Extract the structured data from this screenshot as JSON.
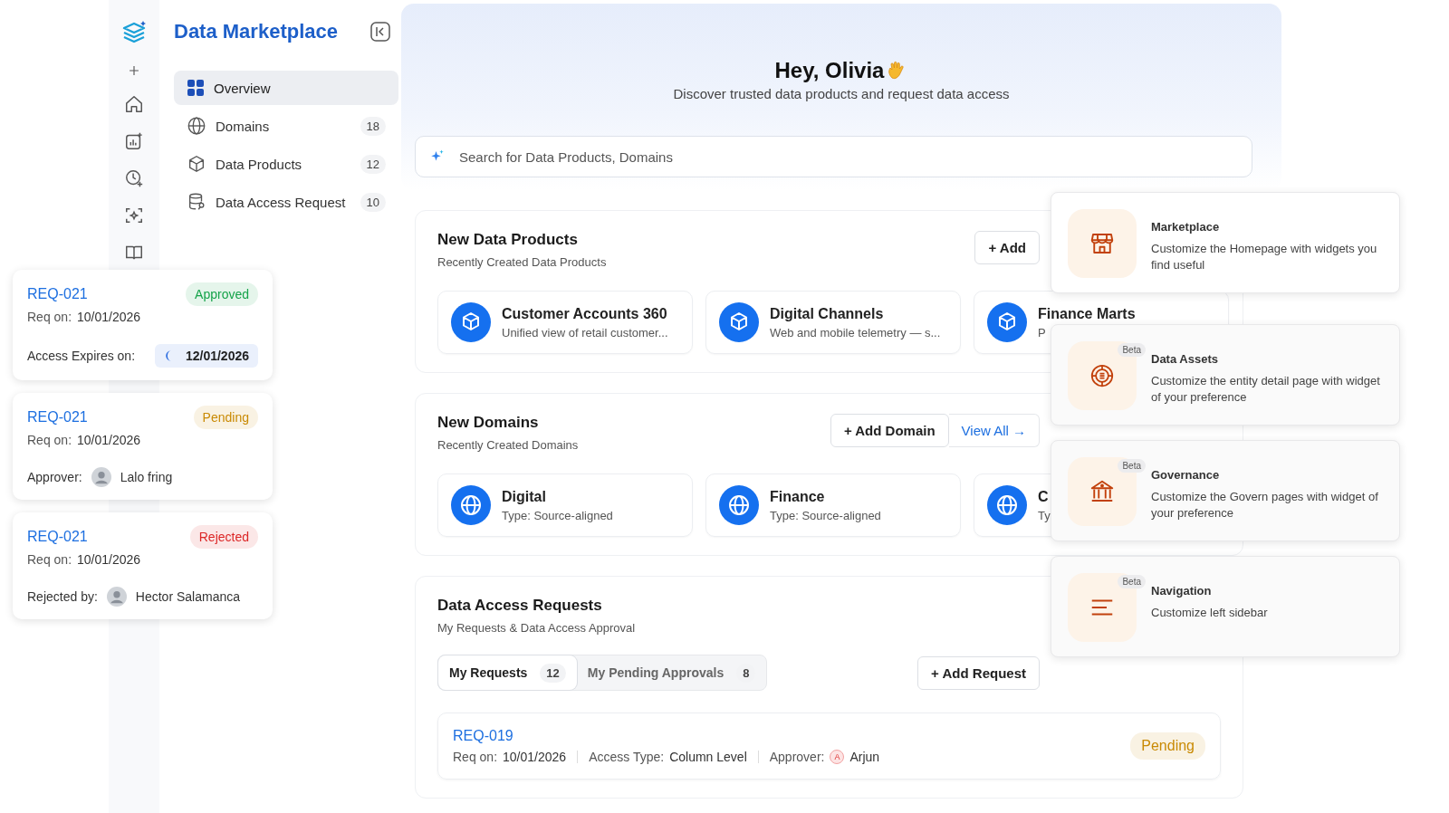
{
  "app": {
    "title": "Data Marketplace"
  },
  "nav": {
    "items": [
      {
        "label": "Overview",
        "kind": "grid",
        "selected": true
      },
      {
        "label": "Domains",
        "kind": "globe",
        "count": "18",
        "selected": false
      },
      {
        "label": "Data Products",
        "kind": "cube",
        "count": "12",
        "selected": false
      },
      {
        "label": "Data Access Request",
        "kind": "database",
        "count": "10",
        "selected": false
      }
    ]
  },
  "hero": {
    "greeting": "Hey, Olivia",
    "subtitle": "Discover trusted data products and request data access"
  },
  "search": {
    "placeholder": "Search for Data Products, Domains"
  },
  "data_products": {
    "title": "New Data Products",
    "subtitle": "Recently Created Data Products",
    "actions": [
      {
        "label": "+ Add",
        "kind": "button"
      }
    ],
    "items": [
      {
        "name": "Customer Accounts 360",
        "description": "Unified view of retail customer..."
      },
      {
        "name": "Digital Channels",
        "description": "Web and mobile telemetry — s..."
      },
      {
        "name": "Finance Marts",
        "description": "P"
      }
    ]
  },
  "domains": {
    "title": "New Domains",
    "subtitle": "Recently Created Domains",
    "actions": [
      {
        "label": "+ Add Domain",
        "kind": "button"
      },
      {
        "label": "View All →",
        "kind": "link"
      }
    ],
    "items": [
      {
        "name": "Digital",
        "description": "Type: Source-aligned"
      },
      {
        "name": "Finance",
        "description": "Type: Source-aligned"
      },
      {
        "name": "C",
        "description": "Ty"
      }
    ]
  },
  "access_requests": {
    "title": "Data Access Requests",
    "subtitle": "My Requests & Data Access Approval",
    "tabs": [
      {
        "label": "My Requests",
        "count": "12",
        "selected": true
      },
      {
        "label": "My Pending Approvals",
        "count": "8",
        "selected": false
      }
    ],
    "action": "+ Add Request",
    "rows": [
      {
        "id": "REQ-019",
        "req_label": "Req on:",
        "req_date": "10/01/2026",
        "type_label": "Access Type:",
        "type_value": "Column Level",
        "approver_label": "Approver:",
        "approver_initial": "A",
        "approver": "Arjun",
        "status": "Pending",
        "color": "#c98a04"
      }
    ]
  },
  "request_cards": [
    {
      "id": "REQ-021",
      "status": "Approved",
      "color": "#16a34a",
      "req_label": "Req on:",
      "req_date": "10/01/2026",
      "kind": "expiry",
      "footer_label": "Access Expires on:",
      "footer_value": "12/01/2026"
    },
    {
      "id": "REQ-021",
      "status": "Pending",
      "color": "#c98a04",
      "req_label": "Req on:",
      "req_date": "10/01/2026",
      "kind": "person",
      "footer_label": "Approver:",
      "footer_value": "Lalo fring"
    },
    {
      "id": "REQ-021",
      "status": "Rejected",
      "color": "#dc2626",
      "req_label": "Req on:",
      "req_date": "10/01/2026",
      "kind": "person",
      "footer_label": "Rejected by:",
      "footer_value": "Hector Salamanca"
    }
  ],
  "widgets": [
    {
      "kind": "store",
      "title": "Marketplace",
      "description": "Customize the Homepage with widgets you find useful"
    },
    {
      "kind": "target",
      "title": "Data Assets",
      "badge": "Beta",
      "description": "Customize the entity detail page with widget of your preference"
    },
    {
      "kind": "bank",
      "title": "Governance",
      "badge": "Beta",
      "description": "Customize the Govern pages with widget of your preference"
    },
    {
      "kind": "menu",
      "title": "Navigation",
      "badge": "Beta",
      "description": "Customize left sidebar"
    }
  ]
}
